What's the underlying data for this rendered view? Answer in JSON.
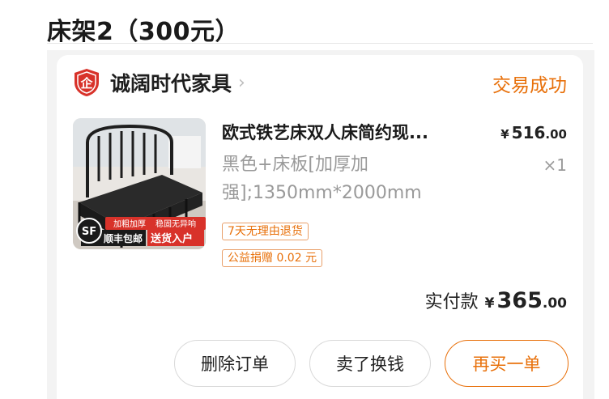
{
  "page": {
    "heading": "床架2（300元）"
  },
  "shop": {
    "name": "诚阔时代家具",
    "chevron": "›",
    "logo_icon": "enterprise-shield-icon",
    "logo_text": "企"
  },
  "order": {
    "status": "交易成功"
  },
  "product": {
    "title": "欧式铁艺床双人床简约现...",
    "spec": "黑色+床板[加厚加强];1350mm*2000mm",
    "price_currency": "¥",
    "price_int": "516",
    "price_dec": ".00",
    "quantity": "×1",
    "image_badges": {
      "sf": "SF",
      "shipping": "顺丰包邮",
      "delivery": "送货入户",
      "feature_1": "加粗加厚",
      "feature_2": "稳固无异响"
    }
  },
  "tags": [
    "7天无理由退货",
    "公益捐赠 0.02 元"
  ],
  "payment": {
    "label": "实付款",
    "currency": "¥",
    "int": "365",
    "dec": ".00"
  },
  "actions": {
    "delete": "删除订单",
    "sell": "卖了换钱",
    "rebuy": "再买一单"
  },
  "colors": {
    "accent": "#e8700a",
    "shop_logo": "#d8322a"
  }
}
